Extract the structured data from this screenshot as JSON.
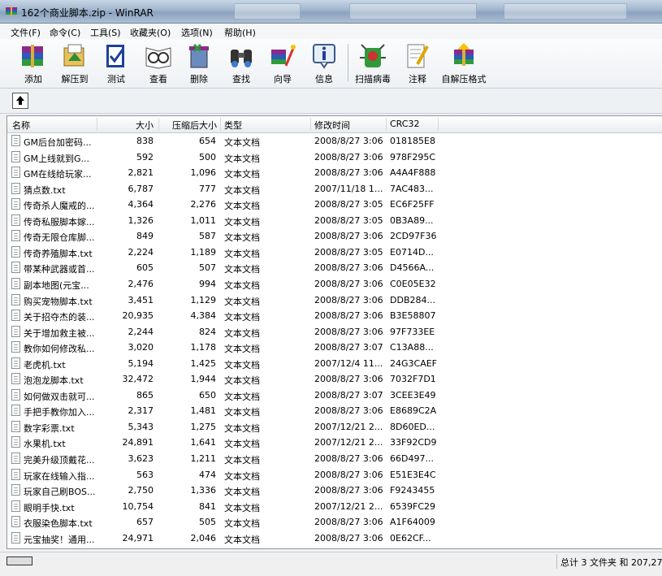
{
  "window": {
    "title": "162个商业脚本.zip - WinRAR",
    "icon": "winrar-books-icon"
  },
  "menu": [
    {
      "label": "文件(F)"
    },
    {
      "label": "命令(C)"
    },
    {
      "label": "工具(S)"
    },
    {
      "label": "收藏夹(O)"
    },
    {
      "label": "选项(N)"
    },
    {
      "label": "帮助(H)"
    }
  ],
  "toolbar": [
    {
      "label": "添加",
      "icon": "add-archive-icon"
    },
    {
      "label": "解压到",
      "icon": "extract-to-icon"
    },
    {
      "label": "测试",
      "icon": "test-icon"
    },
    {
      "label": "查看",
      "icon": "view-icon"
    },
    {
      "label": "删除",
      "icon": "delete-icon"
    },
    {
      "label": "查找",
      "icon": "find-icon"
    },
    {
      "label": "向导",
      "icon": "wizard-icon"
    },
    {
      "label": "信息",
      "icon": "info-icon"
    },
    {
      "label": "扫描病毒",
      "icon": "virus-scan-icon"
    },
    {
      "label": "注释",
      "icon": "comment-icon"
    },
    {
      "label": "自解压格式",
      "icon": "sfx-icon"
    }
  ],
  "columns": {
    "name": "名称",
    "size": "大小",
    "packed": "压缩后大小",
    "type": "类型",
    "modified": "修改时间",
    "crc": "CRC32"
  },
  "files": [
    {
      "name": "GM后台加密码...",
      "size": "838",
      "packed": "654",
      "type": "文本文档",
      "modified": "2008/8/27 3:06",
      "crc": "018185E8"
    },
    {
      "name": "GM上线就到G...",
      "size": "592",
      "packed": "500",
      "type": "文本文档",
      "modified": "2008/8/27 3:06",
      "crc": "978F295C"
    },
    {
      "name": "GM在线给玩家...",
      "size": "2,821",
      "packed": "1,096",
      "type": "文本文档",
      "modified": "2008/8/27 3:06",
      "crc": "A4A4F888"
    },
    {
      "name": "猜点数.txt",
      "size": "6,787",
      "packed": "777",
      "type": "文本文档",
      "modified": "2007/11/18 1...",
      "crc": "7AC483..."
    },
    {
      "name": "传奇杀人魔戒的...",
      "size": "4,364",
      "packed": "2,276",
      "type": "文本文档",
      "modified": "2008/8/27 3:05",
      "crc": "EC6F25FF"
    },
    {
      "name": "传奇私服脚本嫁...",
      "size": "1,326",
      "packed": "1,011",
      "type": "文本文档",
      "modified": "2008/8/27 3:05",
      "crc": "0B3A89..."
    },
    {
      "name": "传奇无限仓库脚...",
      "size": "849",
      "packed": "587",
      "type": "文本文档",
      "modified": "2008/8/27 3:06",
      "crc": "2CD97F36"
    },
    {
      "name": "传奇养殖脚本.txt",
      "size": "2,224",
      "packed": "1,189",
      "type": "文本文档",
      "modified": "2008/8/27 3:05",
      "crc": "E0714D..."
    },
    {
      "name": "带某种武器或首...",
      "size": "605",
      "packed": "507",
      "type": "文本文档",
      "modified": "2008/8/27 3:06",
      "crc": "D4566A..."
    },
    {
      "name": "副本地图(元宝...",
      "size": "2,476",
      "packed": "994",
      "type": "文本文档",
      "modified": "2008/8/27 3:06",
      "crc": "C0E05E32"
    },
    {
      "name": "购买宠物脚本.txt",
      "size": "3,451",
      "packed": "1,129",
      "type": "文本文档",
      "modified": "2008/8/27 3:06",
      "crc": "DDB284..."
    },
    {
      "name": "关于招夺杰的装...",
      "size": "20,935",
      "packed": "4,384",
      "type": "文本文档",
      "modified": "2008/8/27 3:06",
      "crc": "B3E58807"
    },
    {
      "name": "关于增加救主被...",
      "size": "2,244",
      "packed": "824",
      "type": "文本文档",
      "modified": "2008/8/27 3:06",
      "crc": "97F733EE"
    },
    {
      "name": "教你如何修改私...",
      "size": "3,020",
      "packed": "1,178",
      "type": "文本文档",
      "modified": "2008/8/27 3:07",
      "crc": "C13A88..."
    },
    {
      "name": "老虎机.txt",
      "size": "5,194",
      "packed": "1,425",
      "type": "文本文档",
      "modified": "2007/12/4 11...",
      "crc": "24G3CAEF"
    },
    {
      "name": "泡泡龙脚本.txt",
      "size": "32,472",
      "packed": "1,944",
      "type": "文本文档",
      "modified": "2008/8/27 3:06",
      "crc": "7032F7D1"
    },
    {
      "name": "如何做双击就可...",
      "size": "865",
      "packed": "650",
      "type": "文本文档",
      "modified": "2008/8/27 3:07",
      "crc": "3CEE3E49"
    },
    {
      "name": "手把手教你加入...",
      "size": "2,317",
      "packed": "1,481",
      "type": "文本文档",
      "modified": "2008/8/27 3:06",
      "crc": "E8689C2A"
    },
    {
      "name": "数字彩票.txt",
      "size": "5,343",
      "packed": "1,275",
      "type": "文本文档",
      "modified": "2007/12/21 2...",
      "crc": "8D60ED..."
    },
    {
      "name": "水果机.txt",
      "size": "24,891",
      "packed": "1,641",
      "type": "文本文档",
      "modified": "2007/12/21 2...",
      "crc": "33F92CD9"
    },
    {
      "name": "完美升级顶戴花...",
      "size": "3,623",
      "packed": "1,211",
      "type": "文本文档",
      "modified": "2008/8/27 3:06",
      "crc": "66D497..."
    },
    {
      "name": "玩家在线输入指...",
      "size": "563",
      "packed": "474",
      "type": "文本文档",
      "modified": "2008/8/27 3:06",
      "crc": "E51E3E4C"
    },
    {
      "name": "玩家自己刷BOS...",
      "size": "2,750",
      "packed": "1,336",
      "type": "文本文档",
      "modified": "2008/8/27 3:06",
      "crc": "F9243455"
    },
    {
      "name": "眼明手快.txt",
      "size": "10,754",
      "packed": "841",
      "type": "文本文档",
      "modified": "2007/12/21 2...",
      "crc": "6539FC29"
    },
    {
      "name": "衣服染色脚本.txt",
      "size": "657",
      "packed": "505",
      "type": "文本文档",
      "modified": "2008/8/27 3:06",
      "crc": "A1F64009"
    },
    {
      "name": "元宝抽奖！通用...",
      "size": "24,971",
      "packed": "2,046",
      "type": "文本文档",
      "modified": "2008/8/27 3:06",
      "crc": "0E62CF..."
    }
  ],
  "status": {
    "summary": "总计 3 文件夹 和 207,27"
  }
}
